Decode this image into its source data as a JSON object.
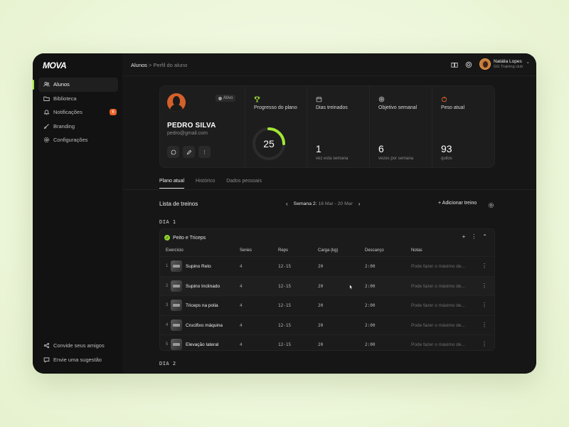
{
  "brand": {
    "logo": "MOVA",
    "accent": "#a3e635"
  },
  "sidebar": {
    "items": [
      {
        "label": "Alunos",
        "icon": "users-icon",
        "active": true
      },
      {
        "label": "Biblioteca",
        "icon": "folder-icon"
      },
      {
        "label": "Notificações",
        "icon": "bell-icon",
        "badge": "6"
      },
      {
        "label": "Branding",
        "icon": "brush-icon"
      },
      {
        "label": "Configurações",
        "icon": "gear-icon"
      }
    ],
    "bottom": [
      {
        "label": "Convide seus amigos",
        "icon": "share-icon"
      },
      {
        "label": "Envie uma sugestão",
        "icon": "chat-icon"
      }
    ]
  },
  "header": {
    "breadcrumb": [
      "Alunos",
      "Perfil do aluno"
    ],
    "separator": ">",
    "user": {
      "name": "Natália Lopes",
      "club": "GG Training club"
    }
  },
  "profile": {
    "status": "Ativo",
    "name": "PEDRO SILVA",
    "email": "pedro@gmail.com",
    "metrics": [
      {
        "label": "Progresso do plano",
        "icon": "trophy-icon",
        "value": "25",
        "progress_fraction": 0.25
      },
      {
        "label": "Dias treinados",
        "icon": "calendar-icon",
        "value": "1",
        "sub": "vez esta semana"
      },
      {
        "label": "Objetivo semanal",
        "icon": "target-icon",
        "value": "6",
        "sub": "vezes por semana"
      },
      {
        "label": "Peso atual",
        "icon": "apple-icon",
        "value": "93",
        "sub": "quilos"
      }
    ]
  },
  "tabs": [
    {
      "label": "Plano atual",
      "active": true
    },
    {
      "label": "Histórico"
    },
    {
      "label": "Dados pessoais"
    }
  ],
  "workouts": {
    "title": "Lista de treinos",
    "week_label": "Semana 2:",
    "week_range": "16 Mar - 20 Mar",
    "add_label": "Adicionar treino",
    "days": [
      {
        "label": "DIA 1",
        "block_title": "Peito e Triceps",
        "columns": [
          "Exercício",
          "Series",
          "Reps",
          "Carga (kg)",
          "Descanço",
          "Notas"
        ],
        "rows": [
          {
            "n": "1",
            "name": "Supino Reto",
            "series": "4",
            "reps": "12-15",
            "load": "20",
            "rest": "2:00",
            "notes": "Pode fazer o máximo de..."
          },
          {
            "n": "2",
            "name": "Supino Inclinado",
            "series": "4",
            "reps": "12-15",
            "load": "20",
            "rest": "2:00",
            "notes": "Pode fazer o máximo de..."
          },
          {
            "n": "3",
            "name": "Triceps na polia",
            "series": "4",
            "reps": "12-15",
            "load": "20",
            "rest": "2:00",
            "notes": "Pode fazer o máximo de..."
          },
          {
            "n": "4",
            "name": "Crucifixo máquina",
            "series": "4",
            "reps": "12-15",
            "load": "20",
            "rest": "2:00",
            "notes": "Pode fazer o máximo de..."
          },
          {
            "n": "5",
            "name": "Elevação lateral",
            "series": "4",
            "reps": "12-15",
            "load": "20",
            "rest": "2:00",
            "notes": "Pode fazer o máximo de..."
          }
        ]
      },
      {
        "label": "DIA 2"
      }
    ]
  }
}
